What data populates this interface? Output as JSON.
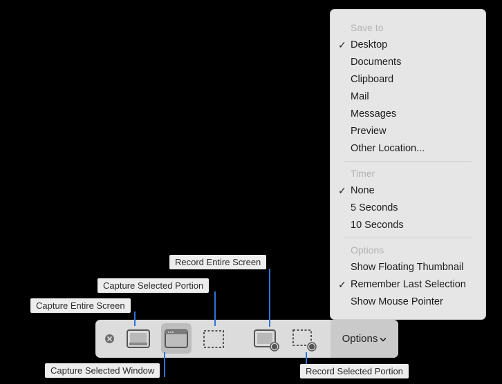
{
  "menu": {
    "save_to_header": "Save to",
    "save_to": [
      {
        "label": "Desktop",
        "checked": true
      },
      {
        "label": "Documents",
        "checked": false
      },
      {
        "label": "Clipboard",
        "checked": false
      },
      {
        "label": "Mail",
        "checked": false
      },
      {
        "label": "Messages",
        "checked": false
      },
      {
        "label": "Preview",
        "checked": false
      },
      {
        "label": "Other Location...",
        "checked": false
      }
    ],
    "timer_header": "Timer",
    "timer": [
      {
        "label": "None",
        "checked": true
      },
      {
        "label": "5 Seconds",
        "checked": false
      },
      {
        "label": "10 Seconds",
        "checked": false
      }
    ],
    "options_header": "Options",
    "options": [
      {
        "label": "Show Floating Thumbnail",
        "checked": false
      },
      {
        "label": "Remember Last Selection",
        "checked": true
      },
      {
        "label": "Show Mouse Pointer",
        "checked": false
      }
    ],
    "check_glyph": "✓"
  },
  "toolbar": {
    "options_label": "Options",
    "selected_mode": "capture-selected-window"
  },
  "callouts": {
    "capture_entire_screen": "Capture Entire Screen",
    "capture_selected_window": "Capture Selected Window",
    "capture_selected_portion": "Capture Selected Portion",
    "record_entire_screen": "Record Entire Screen",
    "record_selected_portion": "Record Selected Portion"
  },
  "colors": {
    "accent": "#2f72d9",
    "menu_bg": "#e6e6e6",
    "toolbar_bg": "#dcdcdc"
  }
}
